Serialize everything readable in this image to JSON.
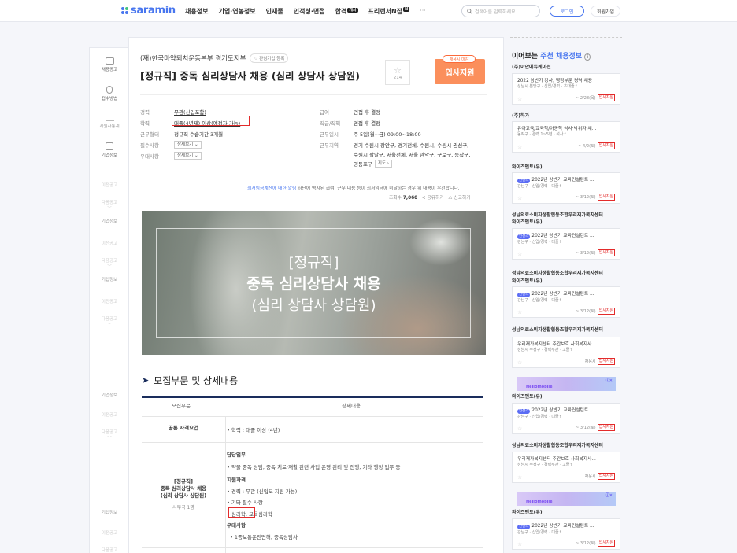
{
  "header": {
    "logo": "saramin",
    "nav": [
      "채용정보",
      "기업·연봉정보",
      "인재풀",
      "인적성·면접",
      "합격",
      "프리랜서N잡",
      "···"
    ],
    "nav_badge_hap": "캐시",
    "nav_badge_free": "N",
    "search_placeholder": "검색어를 입력하세요",
    "login": "로그인",
    "join": "회원가입"
  },
  "left_sidebar": {
    "items": [
      "채용공고",
      "접수방법",
      "지원자통계",
      "기업정보"
    ],
    "faint": [
      "이전공고",
      "다음공고",
      "기업정보",
      "이전공고",
      "다음공고",
      "기업정보",
      "이전공고",
      "다음공고",
      "기업정보",
      "이전공고",
      "다음공고",
      "기업정보",
      "이전공고",
      "다음공고"
    ]
  },
  "job": {
    "company": "(재)한국마약퇴치운동본부 경기도지부",
    "interest": "관심기업 등록",
    "title": "[정규직] 중독 심리상담사 채용 (심리 상담사 상담원)",
    "star_count": "214",
    "apply_badge": "채용시 마감",
    "apply": "입사지원",
    "left_info": [
      {
        "label": "경력",
        "value": "무관(신입포함)"
      },
      {
        "label": "학력",
        "value": "대졸(4년제) 이상(예정자 가능)"
      },
      {
        "label": "근무형태",
        "value": "정규직 수습기간 3개월"
      },
      {
        "label": "필수사항",
        "value": "상세보기"
      },
      {
        "label": "우대사항",
        "value": "상세보기"
      }
    ],
    "right_info": [
      {
        "label": "급여",
        "value": "면접 후 결정"
      },
      {
        "label": "직급/직책",
        "value": "면접 후 결정"
      },
      {
        "label": "근무일시",
        "value": "주 5일(월~금) 09:00~18:00"
      },
      {
        "label": "근무지역",
        "value": "경기 수원시 장안구, 경기전체, 수원시, 수원시 권선구,"
      },
      {
        "label": "",
        "value": "수원시 팔달구, 서울전체, 서울 관악구, 구로구, 동작구,"
      },
      {
        "label": "",
        "value": "영등포구"
      }
    ],
    "map_btn": "지도",
    "notice_link": "최저임금계산에 대한 알림",
    "notice_rest": " 하단에 명시된 급여, 근무 내용 등이 최저임금에 미달하는 경우 위 내용이 우선합니다.",
    "views_label": "조회수",
    "views": "7,060",
    "share": "공유하기",
    "report": "신고하기",
    "banner": [
      "[정규직]",
      "중독 심리상담사 채용",
      "(심리 상담사 상담원)"
    ]
  },
  "details": {
    "section_title": "모집부문 및 상세내용",
    "head": [
      "모집부문",
      "상세내용"
    ],
    "row1": {
      "left": "공통 자격요건",
      "right": "• 학력 : 대졸 이상 (4년)"
    },
    "row2": {
      "left": [
        "[정규직]",
        "중독 심리상담사 채용",
        "(심리 상담사 상담원)"
      ],
      "left_sub": "사무국 1명",
      "right": [
        "담당업무",
        "• 약물 중독 상담, 중독 치료·재활 관련 사업 운영 관리 및 진행, 기타 행정 업무 등",
        "지원자격",
        "• 경력 : 무관 (신입도 지원 가능)",
        "• 기타 필수 사항",
        "• 심리학, 교육심리학",
        "우대사항",
        "• 1종보통운전면허, 중독상담사"
      ]
    }
  },
  "right_sidebar": {
    "title_pre": "이어보는",
    "title_accent": "주천 채용정보",
    "cards": [
      {
        "co": "(주)이안에듀케이션",
        "t": "2022 상반기 강사, 행정부문 경력 채용",
        "m": "성남시 분당구 · 신입/경력 · 초대졸↑",
        "d": "~ 2/28(목)",
        "a": "입사지원"
      },
      {
        "co": "(주)하가",
        "t": "유아교육/교육학/아동학 석사·박위자 채...",
        "m": "동작구 · 경력 1~5년 · 석사↑",
        "d": "~ 4/2(토)",
        "a": "입사지원"
      },
      {
        "co": "와이즈멘토(유)",
        "t": "2022년 상반기 교육컨설턴트 ...",
        "m": "강남구 · 신입/경력 · 대졸↑",
        "d": "~ 3/12(토)",
        "a": "입사지원"
      },
      {
        "co": "성남의료소비자생활협동조합우리재가복지센터",
        "co2": "와이즈멘토(유)",
        "t": "2022년 상반기 교육컨설턴트 ...",
        "m": "강남구 · 신입/경력 · 대졸↑",
        "d": "~ 3/12(토)",
        "a": "입사지원"
      },
      {
        "co": "성남의료소비자생활협동조합우리재가복지센터",
        "co2": "와이즈멘토(유)",
        "t": "2022년 상반기 교육컨설턴트 ...",
        "m": "강남구 · 신입/경력 · 대졸↑",
        "d": "~ 3/12(토)",
        "a": "입사지원"
      },
      {
        "co": "성남의료소비자생활협동조합우리재가복지센터",
        "t": "우리재가복지센터 주간보호 사회복지사...",
        "m": "성남시 수정구 · 경력무관 · 고졸↑",
        "d": "채용시",
        "a": "입사지원"
      },
      {
        "co": "와이즈멘토(유)",
        "t": "2022년 상반기 교육컨설턴트 ...",
        "m": "강남구 · 신입/경력 · 대졸↑",
        "d": "~ 3/12(토)",
        "a": "입사지원"
      },
      {
        "co": "성남의료소비자생활협동조합우리재가복지센터",
        "t": "우리재가복지센터 주간보호 사회복지사...",
        "m": "성남시 수정구 · 경력무관 · 고졸↑",
        "d": "채용시",
        "a": "입사지원"
      },
      {
        "co": "와이즈멘토(유)",
        "t": "2022년 상반기 교육컨설턴트 ...",
        "m": "강남구 · 신입/경력 · 대졸↑",
        "d": "~ 3/12(토)",
        "a": "입사지원"
      }
    ],
    "pill": "인천스",
    "ad": "Hellomobile"
  }
}
